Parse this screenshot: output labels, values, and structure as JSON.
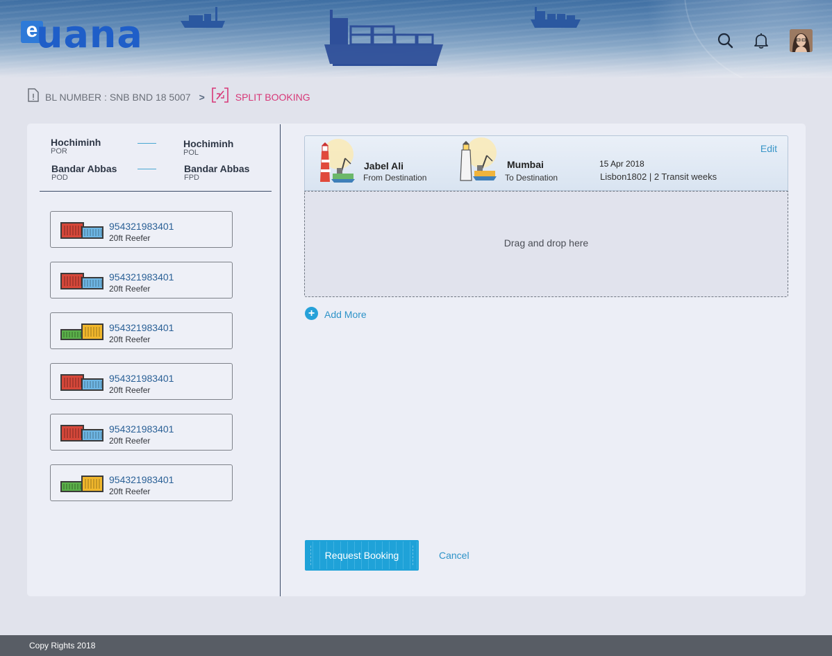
{
  "app": {
    "logo_letter": "e",
    "logo_text": "uana"
  },
  "header": {
    "icons": [
      "search-icon",
      "bell-icon"
    ],
    "avatar": "user-avatar"
  },
  "breadcrumb": {
    "bl_label": "BL NUMBER : SNB BND 18 5007",
    "separator": ">",
    "current": "SPLIT BOOKING"
  },
  "route": {
    "por": {
      "city": "Hochiminh",
      "code": "POR"
    },
    "pol": {
      "city": "Hochiminh",
      "code": "POL"
    },
    "pod": {
      "city": "Bandar Abbas",
      "code": "POD"
    },
    "fpd": {
      "city": "Bandar Abbas",
      "code": "FPD"
    }
  },
  "containers": [
    {
      "number": "954321983401",
      "type": "20ft Reefer",
      "color": "red"
    },
    {
      "number": "954321983401",
      "type": "20ft Reefer",
      "color": "red"
    },
    {
      "number": "954321983401",
      "type": "20ft Reefer",
      "color": "green-yellow"
    },
    {
      "number": "954321983401",
      "type": "20ft Reefer",
      "color": "red"
    },
    {
      "number": "954321983401",
      "type": "20ft Reefer",
      "color": "red"
    },
    {
      "number": "954321983401",
      "type": "20ft Reefer",
      "color": "green-yellow"
    }
  ],
  "booking": {
    "from_port": "Jabel Ali",
    "from_label": "From Destination",
    "to_port": "Mumbai",
    "to_label": "To Destination",
    "date": "15 Apr 2018",
    "voyage": "Lisbon1802  |  2 Transit weeks",
    "edit_label": "Edit"
  },
  "dropzone": {
    "text": "Drag and drop here"
  },
  "add_more": {
    "label": "Add More"
  },
  "actions": {
    "request_label": "Request  Booking",
    "cancel_label": "Cancel"
  },
  "footer": {
    "text": "Copy Rights 2018"
  },
  "colors": {
    "accent": "#26a1d9",
    "breadcrumb_active": "#d73777",
    "link": "#2e93c8",
    "footer": "#585d65"
  }
}
